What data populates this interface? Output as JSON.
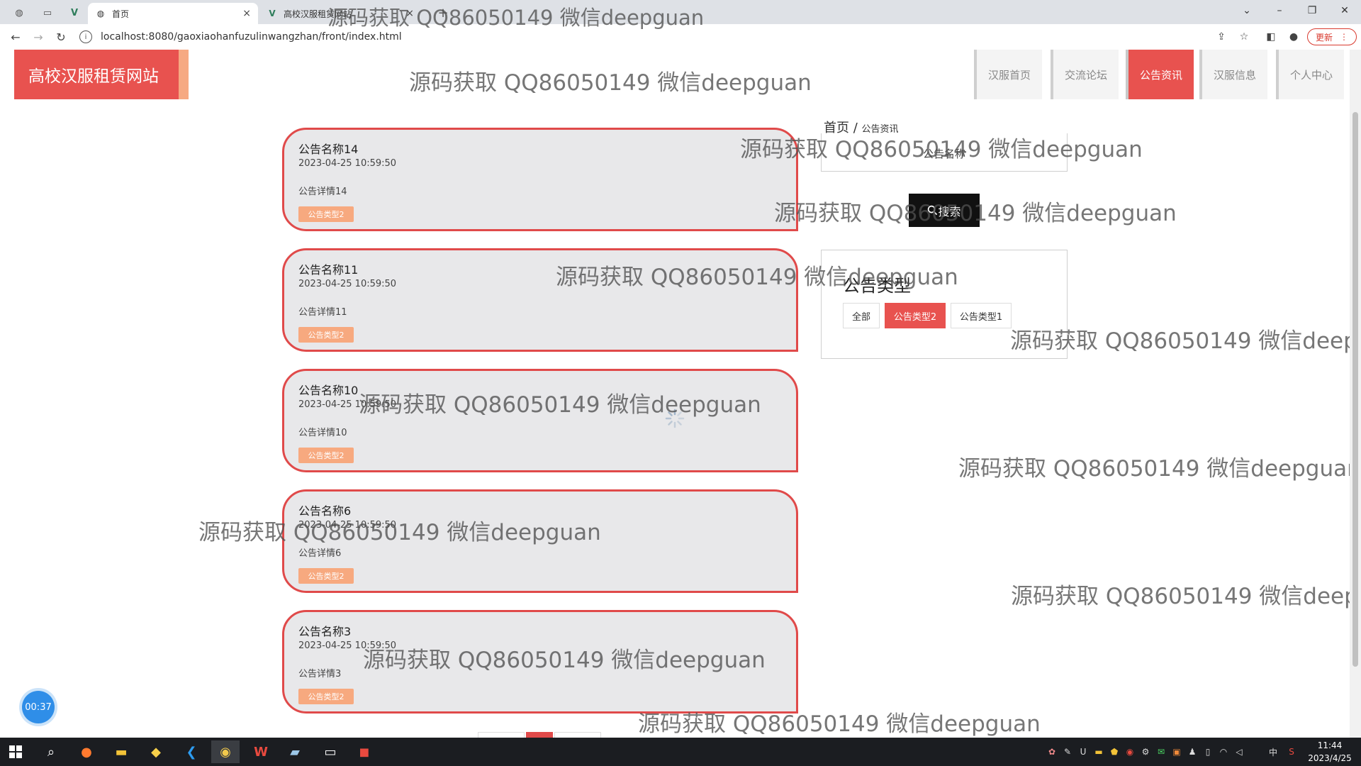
{
  "browser": {
    "tabs": [
      {
        "label": "首页",
        "icon": "globe-icon",
        "active": true
      },
      {
        "label": "高校汉服租赁网站",
        "icon": "vue-icon",
        "active": false
      }
    ],
    "new_tab_icon": "plus-icon",
    "url": "localhost:8080/gaoxiaohanfuzulinwangzhan/front/index.html",
    "update_label": "更新",
    "accent": "#d93a2f"
  },
  "site": {
    "logo": "高校汉服租赁网站",
    "nav": [
      {
        "label": "汉服首页",
        "active": false
      },
      {
        "label": "交流论坛",
        "active": false
      },
      {
        "label": "公告资讯",
        "active": true
      },
      {
        "label": "汉服信息",
        "active": false
      },
      {
        "label": "个人中心",
        "active": false
      }
    ],
    "brand_color": "#e8524f"
  },
  "notices": [
    {
      "title": "公告名称14",
      "time": "2023-04-25 10:59:50",
      "detail": "公告详情14",
      "type": "公告类型2"
    },
    {
      "title": "公告名称11",
      "time": "2023-04-25 10:59:50",
      "detail": "公告详情11",
      "type": "公告类型2"
    },
    {
      "title": "公告名称10",
      "time": "2023-04-25 10:59:50",
      "detail": "公告详情10",
      "type": "公告类型2"
    },
    {
      "title": "公告名称6",
      "time": "2023-04-25 10:59:50",
      "detail": "公告详情6",
      "type": "公告类型2"
    },
    {
      "title": "公告名称3",
      "time": "2023-04-25 10:59:50",
      "detail": "公告详情3",
      "type": "公告类型2"
    }
  ],
  "breadcrumb": {
    "home": "首页",
    "separator": "/",
    "current": "公告资讯"
  },
  "search": {
    "placeholder": "公告名称",
    "button": "搜索",
    "icon": "search-icon"
  },
  "type_filter": {
    "title": "公告类型",
    "options": [
      {
        "label": "全部",
        "active": false
      },
      {
        "label": "公告类型2",
        "active": true
      },
      {
        "label": "公告类型1",
        "active": false
      }
    ]
  },
  "timer": "00:37",
  "watermark": "源码获取 QQ86050149 微信deepguan",
  "taskbar": {
    "clock_time": "11:44",
    "clock_date": "2023/4/25",
    "ime": "中"
  }
}
